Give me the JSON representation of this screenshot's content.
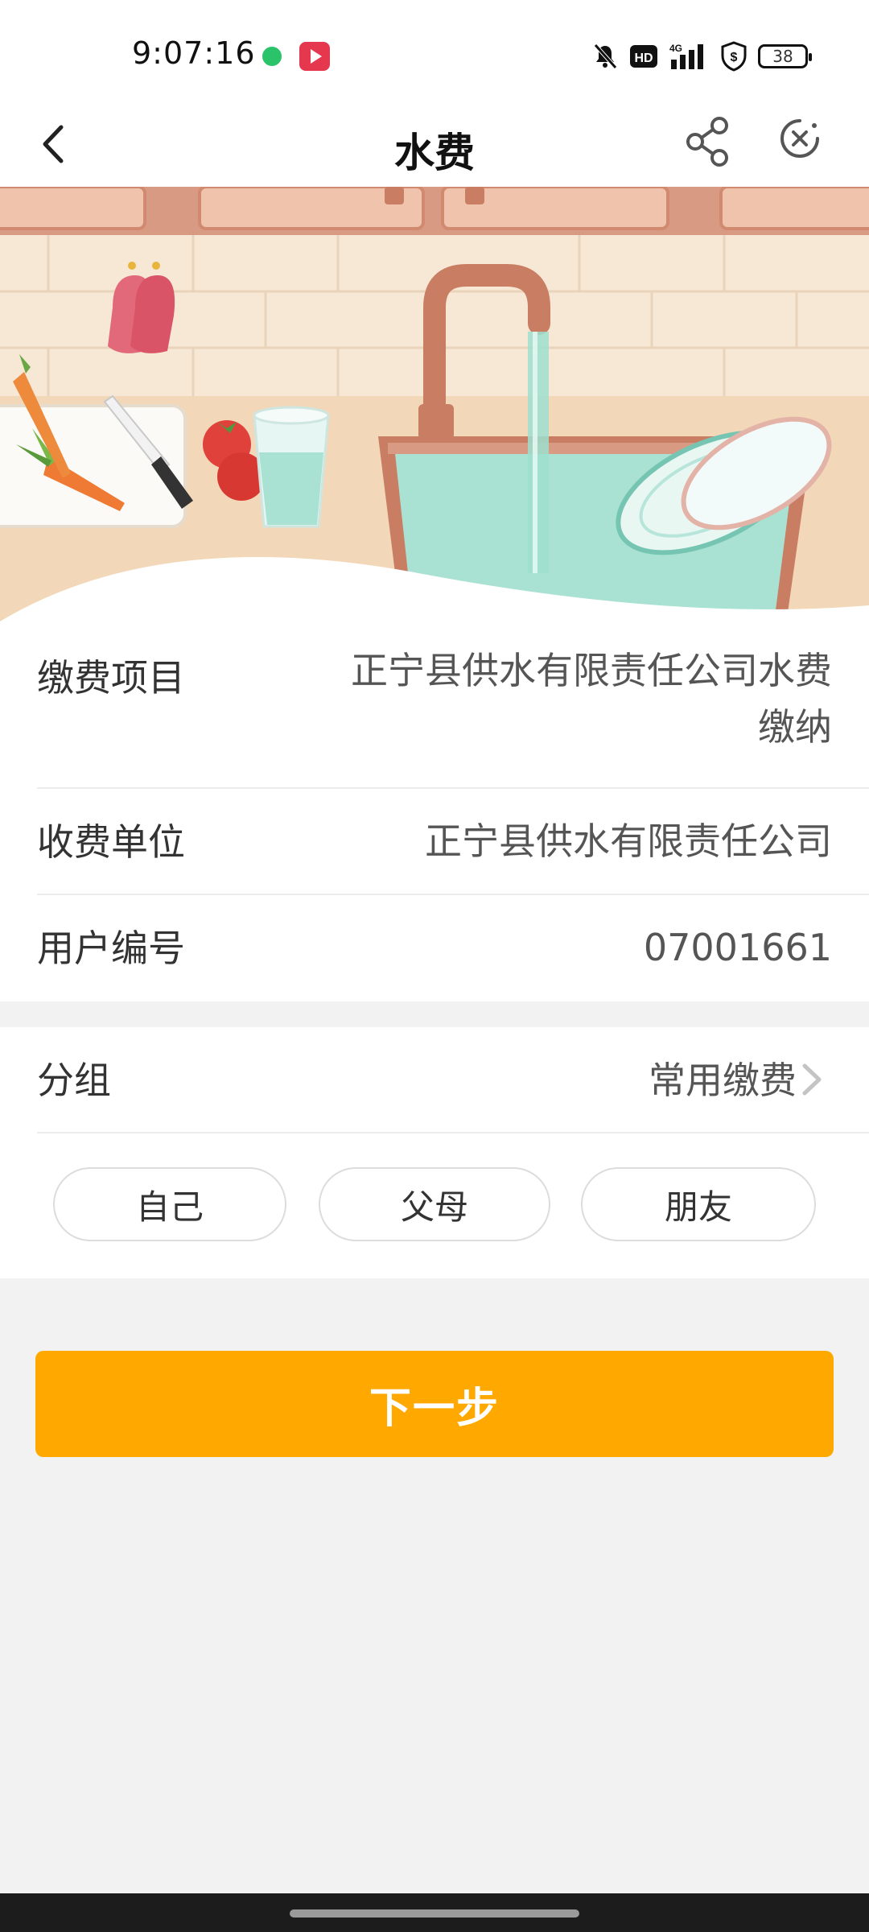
{
  "status_bar": {
    "time": "9:07:16",
    "network": "4G",
    "hd": "HD",
    "battery": "38"
  },
  "header": {
    "title": "水费"
  },
  "bill_info": {
    "item_label": "缴费项目",
    "item_value": "正宁县供水有限责任公司水费缴纳",
    "payee_label": "收费单位",
    "payee_value": "正宁县供水有限责任公司",
    "account_label": "用户编号",
    "account_value": "07001661"
  },
  "group": {
    "label": "分组",
    "value": "常用缴费",
    "options": [
      "自己",
      "父母",
      "朋友"
    ]
  },
  "next_button": "下一步",
  "colors": {
    "accent": "#ffa800",
    "background": "#f2f2f2"
  }
}
